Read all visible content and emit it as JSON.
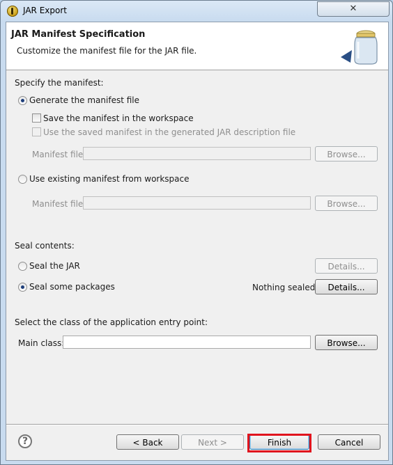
{
  "window": {
    "title": "JAR Export",
    "close_label": "✕"
  },
  "header": {
    "title": "JAR Manifest Specification",
    "description": "Customize the manifest file for the JAR file."
  },
  "manifest": {
    "section_label": "Specify the manifest:",
    "generate_option": "Generate the manifest file",
    "save_in_workspace": "Save the manifest in the workspace",
    "use_saved_in_description": "Use the saved manifest in the generated JAR description file",
    "manifest_file_label": "Manifest file:",
    "browse_label": "Browse...",
    "use_existing_option": "Use existing manifest from workspace",
    "existing_manifest_file_label": "Manifest file:",
    "existing_browse_label": "Browse..."
  },
  "seal": {
    "section_label": "Seal contents:",
    "seal_jar_option": "Seal the JAR",
    "seal_jar_details": "Details...",
    "seal_some_option": "Seal some packages",
    "status": "Nothing sealed",
    "seal_some_details": "Details..."
  },
  "entry_point": {
    "section_label": "Select the class of the application entry point:",
    "main_class_label": "Main class:",
    "main_class_value": "",
    "browse_label": "Browse..."
  },
  "footer": {
    "help_label": "?",
    "back_label": "< Back",
    "next_label": "Next >",
    "finish_label": "Finish",
    "cancel_label": "Cancel"
  }
}
